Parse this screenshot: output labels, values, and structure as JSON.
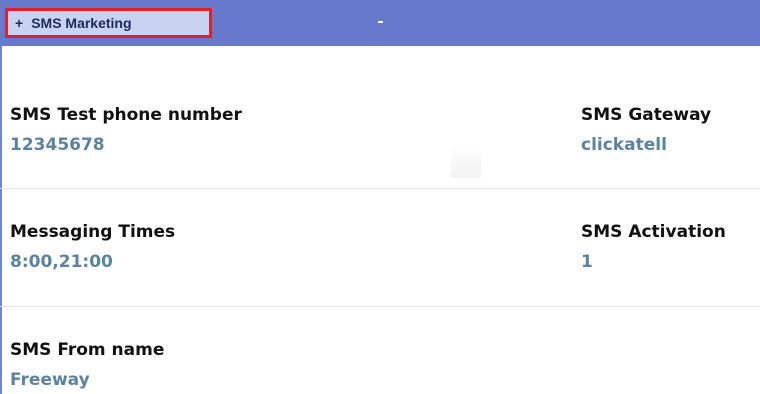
{
  "panel": {
    "header": {
      "toggle_symbol": "+",
      "title": "SMS Marketing"
    },
    "fields": {
      "test_phone": {
        "label": "SMS Test phone number",
        "value": "12345678"
      },
      "gateway": {
        "label": "SMS Gateway",
        "value": "clickatell"
      },
      "messaging_times": {
        "label": "Messaging Times",
        "value": "8:00,21:00"
      },
      "activation": {
        "label": "SMS Activation",
        "value": "1"
      },
      "from_name": {
        "label": "SMS From name",
        "value": "Freeway"
      }
    }
  },
  "colors": {
    "header_bar": "#6679cd",
    "tab_highlight_border": "#e0202a",
    "label_text": "#111111",
    "value_text": "#5a83a0"
  }
}
